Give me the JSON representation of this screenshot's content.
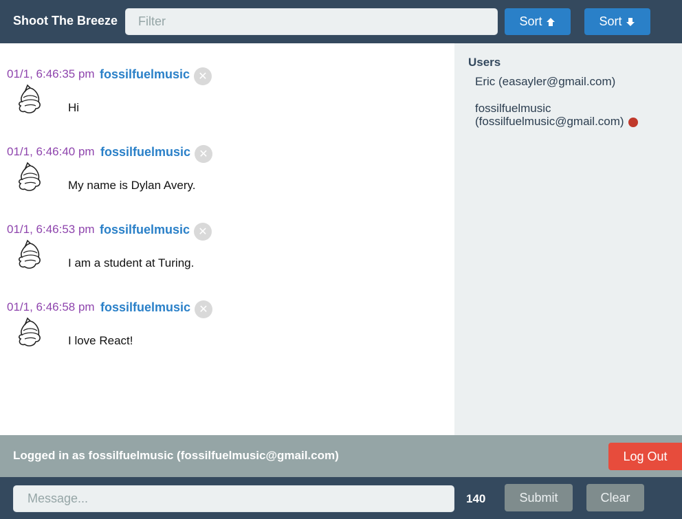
{
  "header": {
    "title": "Shoot The Breeze",
    "filter_placeholder": "Filter",
    "sort_up_label": "Sort",
    "sort_down_label": "Sort"
  },
  "messages": [
    {
      "time": "01/1, 6:46:35 pm",
      "user": "fossilfuelmusic",
      "text": "Hi"
    },
    {
      "time": "01/1, 6:46:40 pm",
      "user": "fossilfuelmusic",
      "text": "My name is Dylan Avery."
    },
    {
      "time": "01/1, 6:46:53 pm",
      "user": "fossilfuelmusic",
      "text": "I am a student at Turing."
    },
    {
      "time": "01/1, 6:46:58 pm",
      "user": "fossilfuelmusic",
      "text": "I love React!"
    }
  ],
  "sidebar": {
    "heading": "Users",
    "users": [
      {
        "name": "Eric",
        "email": "(easayler@gmail.com)",
        "online": false
      },
      {
        "name": "fossilfuelmusic",
        "email": "(fossilfuelmusic@gmail.com)",
        "online": true
      }
    ]
  },
  "status": {
    "logged_in_text": "Logged in as fossilfuelmusic (fossilfuelmusic@gmail.com)",
    "logout_label": "Log Out"
  },
  "composer": {
    "message_placeholder": "Message...",
    "char_count": "140",
    "submit_label": "Submit",
    "clear_label": "Clear"
  },
  "colors": {
    "header_bg": "#34495e",
    "accent_blue": "#2a80c8",
    "timestamp_purple": "#8e44ad",
    "logout_red": "#e74c3c",
    "online_dot": "#c0392b",
    "status_bar_bg": "#95a5a6",
    "sidebar_bg": "#ecf0f1"
  },
  "icons": {
    "sort_up": "arrow-up-icon",
    "sort_down": "arrow-down-icon",
    "delete": "close-icon",
    "avatar": "user-avatar-sketch",
    "online": "online-status-dot"
  }
}
